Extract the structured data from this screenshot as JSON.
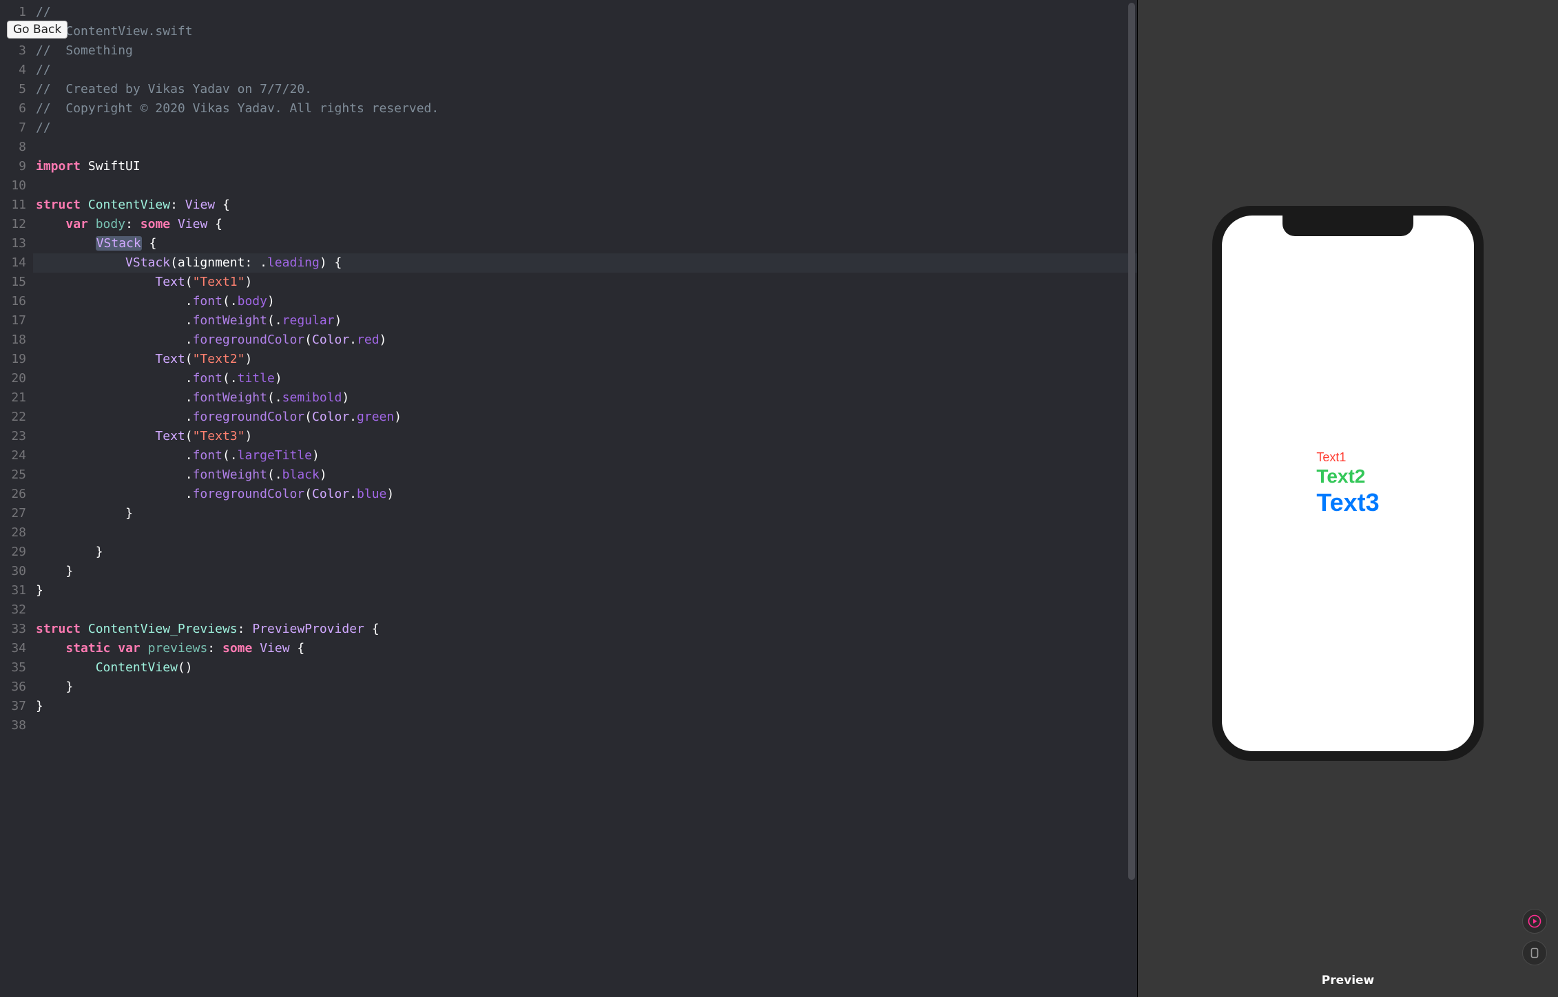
{
  "goBack": "Go Back",
  "previewLabel": "Preview",
  "lineCount": 38,
  "highlightLine": 14,
  "code": {
    "l1": [
      {
        "t": "//",
        "c": "c-comment"
      }
    ],
    "l2": [
      {
        "t": "//  ",
        "c": "c-comment"
      },
      {
        "t": "ContentView.swift",
        "c": "c-comment"
      }
    ],
    "l3": [
      {
        "t": "//  ",
        "c": "c-comment"
      },
      {
        "t": "Something",
        "c": "c-comment"
      }
    ],
    "l4": [
      {
        "t": "//",
        "c": "c-comment"
      }
    ],
    "l5": [
      {
        "t": "//  ",
        "c": "c-comment"
      },
      {
        "t": "Created by Vikas Yadav on 7/7/20.",
        "c": "c-comment"
      }
    ],
    "l6": [
      {
        "t": "//  ",
        "c": "c-comment"
      },
      {
        "t": "Copyright © 2020 Vikas Yadav. All rights reserved.",
        "c": "c-comment"
      }
    ],
    "l7": [
      {
        "t": "//",
        "c": "c-comment"
      }
    ],
    "l8": [],
    "l9": [
      {
        "t": "import",
        "c": "c-keyword"
      },
      {
        "t": " SwiftUI",
        "c": "c-plain"
      }
    ],
    "l10": [],
    "l11": [
      {
        "t": "struct",
        "c": "c-keyword"
      },
      {
        "t": " ",
        "c": ""
      },
      {
        "t": "ContentView",
        "c": "c-type"
      },
      {
        "t": ": ",
        "c": "c-plain"
      },
      {
        "t": "View",
        "c": "c-type2"
      },
      {
        "t": " {",
        "c": "c-plain"
      }
    ],
    "l12": [
      {
        "t": "    ",
        "c": ""
      },
      {
        "t": "var",
        "c": "c-keyword"
      },
      {
        "t": " ",
        "c": ""
      },
      {
        "t": "body",
        "c": "c-prop"
      },
      {
        "t": ": ",
        "c": "c-plain"
      },
      {
        "t": "some",
        "c": "c-keyword"
      },
      {
        "t": " ",
        "c": ""
      },
      {
        "t": "View",
        "c": "c-type2"
      },
      {
        "t": " {",
        "c": "c-plain"
      }
    ],
    "l13": [
      {
        "t": "        ",
        "c": ""
      },
      {
        "t": "VStack",
        "c": "c-type2 sel-box"
      },
      {
        "t": " {",
        "c": "c-plain"
      }
    ],
    "l14": [
      {
        "t": "            ",
        "c": ""
      },
      {
        "t": "VStack",
        "c": "c-type2"
      },
      {
        "t": "(alignment: .",
        "c": "c-plain"
      },
      {
        "t": "leading",
        "c": "c-builtin"
      },
      {
        "t": ") {",
        "c": "c-plain"
      }
    ],
    "l15": [
      {
        "t": "                ",
        "c": ""
      },
      {
        "t": "Text",
        "c": "c-type2"
      },
      {
        "t": "(",
        "c": "c-plain"
      },
      {
        "t": "\"Text1\"",
        "c": "c-string"
      },
      {
        "t": ")",
        "c": "c-plain"
      }
    ],
    "l16": [
      {
        "t": "                    .",
        "c": "c-plain"
      },
      {
        "t": "font",
        "c": "c-func"
      },
      {
        "t": "(.",
        "c": "c-plain"
      },
      {
        "t": "body",
        "c": "c-builtin"
      },
      {
        "t": ")",
        "c": "c-plain"
      }
    ],
    "l17": [
      {
        "t": "                    .",
        "c": "c-plain"
      },
      {
        "t": "fontWeight",
        "c": "c-func"
      },
      {
        "t": "(.",
        "c": "c-plain"
      },
      {
        "t": "regular",
        "c": "c-builtin"
      },
      {
        "t": ")",
        "c": "c-plain"
      }
    ],
    "l18": [
      {
        "t": "                    .",
        "c": "c-plain"
      },
      {
        "t": "foregroundColor",
        "c": "c-func"
      },
      {
        "t": "(",
        "c": "c-plain"
      },
      {
        "t": "Color",
        "c": "c-type2"
      },
      {
        "t": ".",
        "c": "c-plain"
      },
      {
        "t": "red",
        "c": "c-builtin"
      },
      {
        "t": ")",
        "c": "c-plain"
      }
    ],
    "l19": [
      {
        "t": "                ",
        "c": ""
      },
      {
        "t": "Text",
        "c": "c-type2"
      },
      {
        "t": "(",
        "c": "c-plain"
      },
      {
        "t": "\"Text2\"",
        "c": "c-string"
      },
      {
        "t": ")",
        "c": "c-plain"
      }
    ],
    "l20": [
      {
        "t": "                    .",
        "c": "c-plain"
      },
      {
        "t": "font",
        "c": "c-func"
      },
      {
        "t": "(.",
        "c": "c-plain"
      },
      {
        "t": "title",
        "c": "c-builtin"
      },
      {
        "t": ")",
        "c": "c-plain"
      }
    ],
    "l21": [
      {
        "t": "                    .",
        "c": "c-plain"
      },
      {
        "t": "fontWeight",
        "c": "c-func"
      },
      {
        "t": "(.",
        "c": "c-plain"
      },
      {
        "t": "semibold",
        "c": "c-builtin"
      },
      {
        "t": ")",
        "c": "c-plain"
      }
    ],
    "l22": [
      {
        "t": "                    .",
        "c": "c-plain"
      },
      {
        "t": "foregroundColor",
        "c": "c-func"
      },
      {
        "t": "(",
        "c": "c-plain"
      },
      {
        "t": "Color",
        "c": "c-type2"
      },
      {
        "t": ".",
        "c": "c-plain"
      },
      {
        "t": "green",
        "c": "c-builtin"
      },
      {
        "t": ")",
        "c": "c-plain"
      }
    ],
    "l23": [
      {
        "t": "                ",
        "c": ""
      },
      {
        "t": "Text",
        "c": "c-type2"
      },
      {
        "t": "(",
        "c": "c-plain"
      },
      {
        "t": "\"Text3\"",
        "c": "c-string"
      },
      {
        "t": ")",
        "c": "c-plain"
      }
    ],
    "l24": [
      {
        "t": "                    .",
        "c": "c-plain"
      },
      {
        "t": "font",
        "c": "c-func"
      },
      {
        "t": "(.",
        "c": "c-plain"
      },
      {
        "t": "largeTitle",
        "c": "c-builtin"
      },
      {
        "t": ")",
        "c": "c-plain"
      }
    ],
    "l25": [
      {
        "t": "                    .",
        "c": "c-plain"
      },
      {
        "t": "fontWeight",
        "c": "c-func"
      },
      {
        "t": "(.",
        "c": "c-plain"
      },
      {
        "t": "black",
        "c": "c-builtin"
      },
      {
        "t": ")",
        "c": "c-plain"
      }
    ],
    "l26": [
      {
        "t": "                    .",
        "c": "c-plain"
      },
      {
        "t": "foregroundColor",
        "c": "c-func"
      },
      {
        "t": "(",
        "c": "c-plain"
      },
      {
        "t": "Color",
        "c": "c-type2"
      },
      {
        "t": ".",
        "c": "c-plain"
      },
      {
        "t": "blue",
        "c": "c-builtin"
      },
      {
        "t": ")",
        "c": "c-plain"
      }
    ],
    "l27": [
      {
        "t": "            }",
        "c": "c-plain"
      }
    ],
    "l28": [],
    "l29": [
      {
        "t": "        }",
        "c": "c-plain"
      }
    ],
    "l30": [
      {
        "t": "    }",
        "c": "c-plain"
      }
    ],
    "l31": [
      {
        "t": "}",
        "c": "c-plain"
      }
    ],
    "l32": [],
    "l33": [
      {
        "t": "struct",
        "c": "c-keyword"
      },
      {
        "t": " ",
        "c": ""
      },
      {
        "t": "ContentView_Previews",
        "c": "c-type"
      },
      {
        "t": ": ",
        "c": "c-plain"
      },
      {
        "t": "PreviewProvider",
        "c": "c-type2"
      },
      {
        "t": " {",
        "c": "c-plain"
      }
    ],
    "l34": [
      {
        "t": "    ",
        "c": ""
      },
      {
        "t": "static",
        "c": "c-keyword"
      },
      {
        "t": " ",
        "c": ""
      },
      {
        "t": "var",
        "c": "c-keyword"
      },
      {
        "t": " ",
        "c": ""
      },
      {
        "t": "previews",
        "c": "c-prop"
      },
      {
        "t": ": ",
        "c": "c-plain"
      },
      {
        "t": "some",
        "c": "c-keyword"
      },
      {
        "t": " ",
        "c": ""
      },
      {
        "t": "View",
        "c": "c-type2"
      },
      {
        "t": " {",
        "c": "c-plain"
      }
    ],
    "l35": [
      {
        "t": "        ",
        "c": ""
      },
      {
        "t": "ContentView",
        "c": "c-type"
      },
      {
        "t": "()",
        "c": "c-plain"
      }
    ],
    "l36": [
      {
        "t": "    }",
        "c": "c-plain"
      }
    ],
    "l37": [
      {
        "t": "}",
        "c": "c-plain"
      }
    ],
    "l38": []
  },
  "previewTexts": {
    "text1": "Text1",
    "text2": "Text2",
    "text3": "Text3"
  }
}
